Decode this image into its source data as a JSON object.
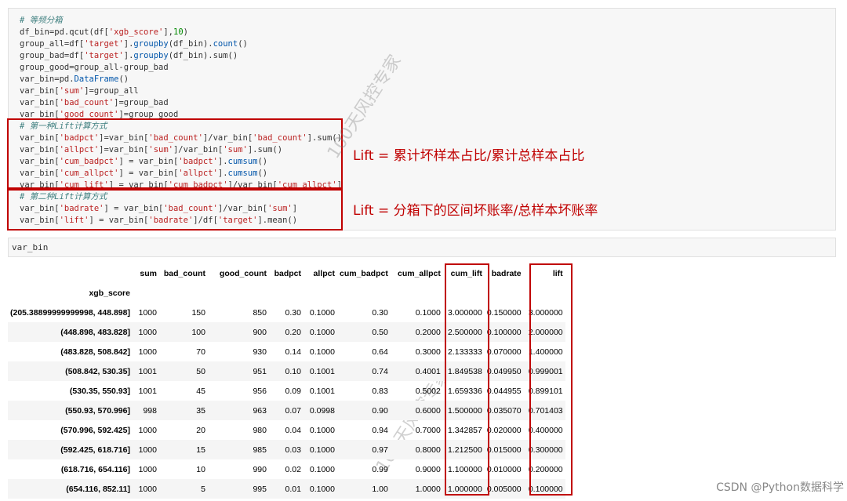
{
  "code_lines": [
    {
      "parts": [
        {
          "t": "# 等频分箱",
          "c": "c-comment"
        }
      ]
    },
    {
      "parts": [
        {
          "t": "df_bin=pd.qcut(df["
        },
        {
          "t": "'xgb_score'",
          "c": "c-str"
        },
        {
          "t": "],"
        },
        {
          "t": "10",
          "c": "c-num"
        },
        {
          "t": ")"
        }
      ]
    },
    {
      "parts": [
        {
          "t": "group_all=df["
        },
        {
          "t": "'target'",
          "c": "c-str"
        },
        {
          "t": "]."
        },
        {
          "t": "groupby",
          "c": "c-fn"
        },
        {
          "t": "(df_bin)."
        },
        {
          "t": "count",
          "c": "c-fn"
        },
        {
          "t": "()"
        }
      ]
    },
    {
      "parts": [
        {
          "t": "group_bad=df["
        },
        {
          "t": "'target'",
          "c": "c-str"
        },
        {
          "t": "]."
        },
        {
          "t": "groupby",
          "c": "c-fn"
        },
        {
          "t": "(df_bin).sum()"
        }
      ]
    },
    {
      "parts": [
        {
          "t": "group_good=group_all-group_bad"
        }
      ]
    },
    {
      "parts": [
        {
          "t": "var_bin=pd."
        },
        {
          "t": "DataFrame",
          "c": "c-fn"
        },
        {
          "t": "()"
        }
      ]
    },
    {
      "parts": [
        {
          "t": "var_bin["
        },
        {
          "t": "'sum'",
          "c": "c-str"
        },
        {
          "t": "]=group_all"
        }
      ]
    },
    {
      "parts": [
        {
          "t": "var_bin["
        },
        {
          "t": "'bad_count'",
          "c": "c-str"
        },
        {
          "t": "]=group_bad"
        }
      ]
    },
    {
      "parts": [
        {
          "t": "var_bin["
        },
        {
          "t": "'good_count'",
          "c": "c-str"
        },
        {
          "t": "]=group_good"
        }
      ]
    },
    {
      "parts": [
        {
          "t": "# 第一种Lift计算方式",
          "c": "c-comment"
        }
      ]
    },
    {
      "parts": [
        {
          "t": "var_bin["
        },
        {
          "t": "'badpct'",
          "c": "c-str"
        },
        {
          "t": "]=var_bin["
        },
        {
          "t": "'bad_count'",
          "c": "c-str"
        },
        {
          "t": "]/var_bin["
        },
        {
          "t": "'bad_count'",
          "c": "c-str"
        },
        {
          "t": "].sum()"
        }
      ]
    },
    {
      "parts": [
        {
          "t": "var_bin["
        },
        {
          "t": "'allpct'",
          "c": "c-str"
        },
        {
          "t": "]=var_bin["
        },
        {
          "t": "'sum'",
          "c": "c-str"
        },
        {
          "t": "]/var_bin["
        },
        {
          "t": "'sum'",
          "c": "c-str"
        },
        {
          "t": "].sum()"
        }
      ]
    },
    {
      "parts": [
        {
          "t": "var_bin["
        },
        {
          "t": "'cum_badpct'",
          "c": "c-str"
        },
        {
          "t": "] = var_bin["
        },
        {
          "t": "'badpct'",
          "c": "c-str"
        },
        {
          "t": "]."
        },
        {
          "t": "cumsum",
          "c": "c-fn"
        },
        {
          "t": "()"
        }
      ]
    },
    {
      "parts": [
        {
          "t": "var_bin["
        },
        {
          "t": "'cum_allpct'",
          "c": "c-str"
        },
        {
          "t": "] = var_bin["
        },
        {
          "t": "'allpct'",
          "c": "c-str"
        },
        {
          "t": "]."
        },
        {
          "t": "cumsum",
          "c": "c-fn"
        },
        {
          "t": "()"
        }
      ]
    },
    {
      "parts": [
        {
          "t": "var_bin["
        },
        {
          "t": "'cum_lift'",
          "c": "c-str"
        },
        {
          "t": "] = var_bin["
        },
        {
          "t": "'cum_badpct'",
          "c": "c-str"
        },
        {
          "t": "]/var_bin["
        },
        {
          "t": "'cum_allpct'",
          "c": "c-str"
        },
        {
          "t": "]"
        }
      ]
    },
    {
      "parts": [
        {
          "t": "# 第二种Lift计算方式",
          "c": "c-comment"
        }
      ]
    },
    {
      "parts": [
        {
          "t": "var_bin["
        },
        {
          "t": "'badrate'",
          "c": "c-str"
        },
        {
          "t": "] = var_bin["
        },
        {
          "t": "'bad_count'",
          "c": "c-str"
        },
        {
          "t": "]/var_bin["
        },
        {
          "t": "'sum'",
          "c": "c-str"
        },
        {
          "t": "]"
        }
      ]
    },
    {
      "parts": [
        {
          "t": "var_bin["
        },
        {
          "t": "'lift'",
          "c": "c-str"
        },
        {
          "t": "] = var_bin["
        },
        {
          "t": "'badrate'",
          "c": "c-str"
        },
        {
          "t": "]/df["
        },
        {
          "t": "'target'",
          "c": "c-str"
        },
        {
          "t": "].mean()"
        }
      ]
    }
  ],
  "annotations": {
    "lift1": "Lift = 累计坏样本占比/累计总样本占比",
    "lift2": "Lift = 分箱下的区间坏账率/总样本坏账率"
  },
  "watermark": "100天风控专家",
  "varbin_cell": "var_bin",
  "table": {
    "columns": [
      "sum",
      "bad_count",
      "good_count",
      "badpct",
      "allpct",
      "cum_badpct",
      "cum_allpct",
      "cum_lift",
      "badrate",
      "lift"
    ],
    "index_name": "xgb_score",
    "rows": [
      [
        "(205.38899999999998, 448.898]",
        "1000",
        "150",
        "850",
        "0.30",
        "0.1000",
        "0.30",
        "0.1000",
        "3.000000",
        "0.150000",
        "3.000000"
      ],
      [
        "(448.898, 483.828]",
        "1000",
        "100",
        "900",
        "0.20",
        "0.1000",
        "0.50",
        "0.2000",
        "2.500000",
        "0.100000",
        "2.000000"
      ],
      [
        "(483.828, 508.842]",
        "1000",
        "70",
        "930",
        "0.14",
        "0.1000",
        "0.64",
        "0.3000",
        "2.133333",
        "0.070000",
        "1.400000"
      ],
      [
        "(508.842, 530.35]",
        "1001",
        "50",
        "951",
        "0.10",
        "0.1001",
        "0.74",
        "0.4001",
        "1.849538",
        "0.049950",
        "0.999001"
      ],
      [
        "(530.35, 550.93]",
        "1001",
        "45",
        "956",
        "0.09",
        "0.1001",
        "0.83",
        "0.5002",
        "1.659336",
        "0.044955",
        "0.899101"
      ],
      [
        "(550.93, 570.996]",
        "998",
        "35",
        "963",
        "0.07",
        "0.0998",
        "0.90",
        "0.6000",
        "1.500000",
        "0.035070",
        "0.701403"
      ],
      [
        "(570.996, 592.425]",
        "1000",
        "20",
        "980",
        "0.04",
        "0.1000",
        "0.94",
        "0.7000",
        "1.342857",
        "0.020000",
        "0.400000"
      ],
      [
        "(592.425, 618.716]",
        "1000",
        "15",
        "985",
        "0.03",
        "0.1000",
        "0.97",
        "0.8000",
        "1.212500",
        "0.015000",
        "0.300000"
      ],
      [
        "(618.716, 654.116]",
        "1000",
        "10",
        "990",
        "0.02",
        "0.1000",
        "0.99",
        "0.9000",
        "1.100000",
        "0.010000",
        "0.200000"
      ],
      [
        "(654.116, 852.11]",
        "1000",
        "5",
        "995",
        "0.01",
        "0.1000",
        "1.00",
        "1.0000",
        "1.000000",
        "0.005000",
        "0.100000"
      ]
    ]
  },
  "credit": "CSDN @Python数据科学",
  "colors": {
    "highlight_box": "#c00000",
    "comment": "#408080",
    "string": "#ba2121"
  }
}
